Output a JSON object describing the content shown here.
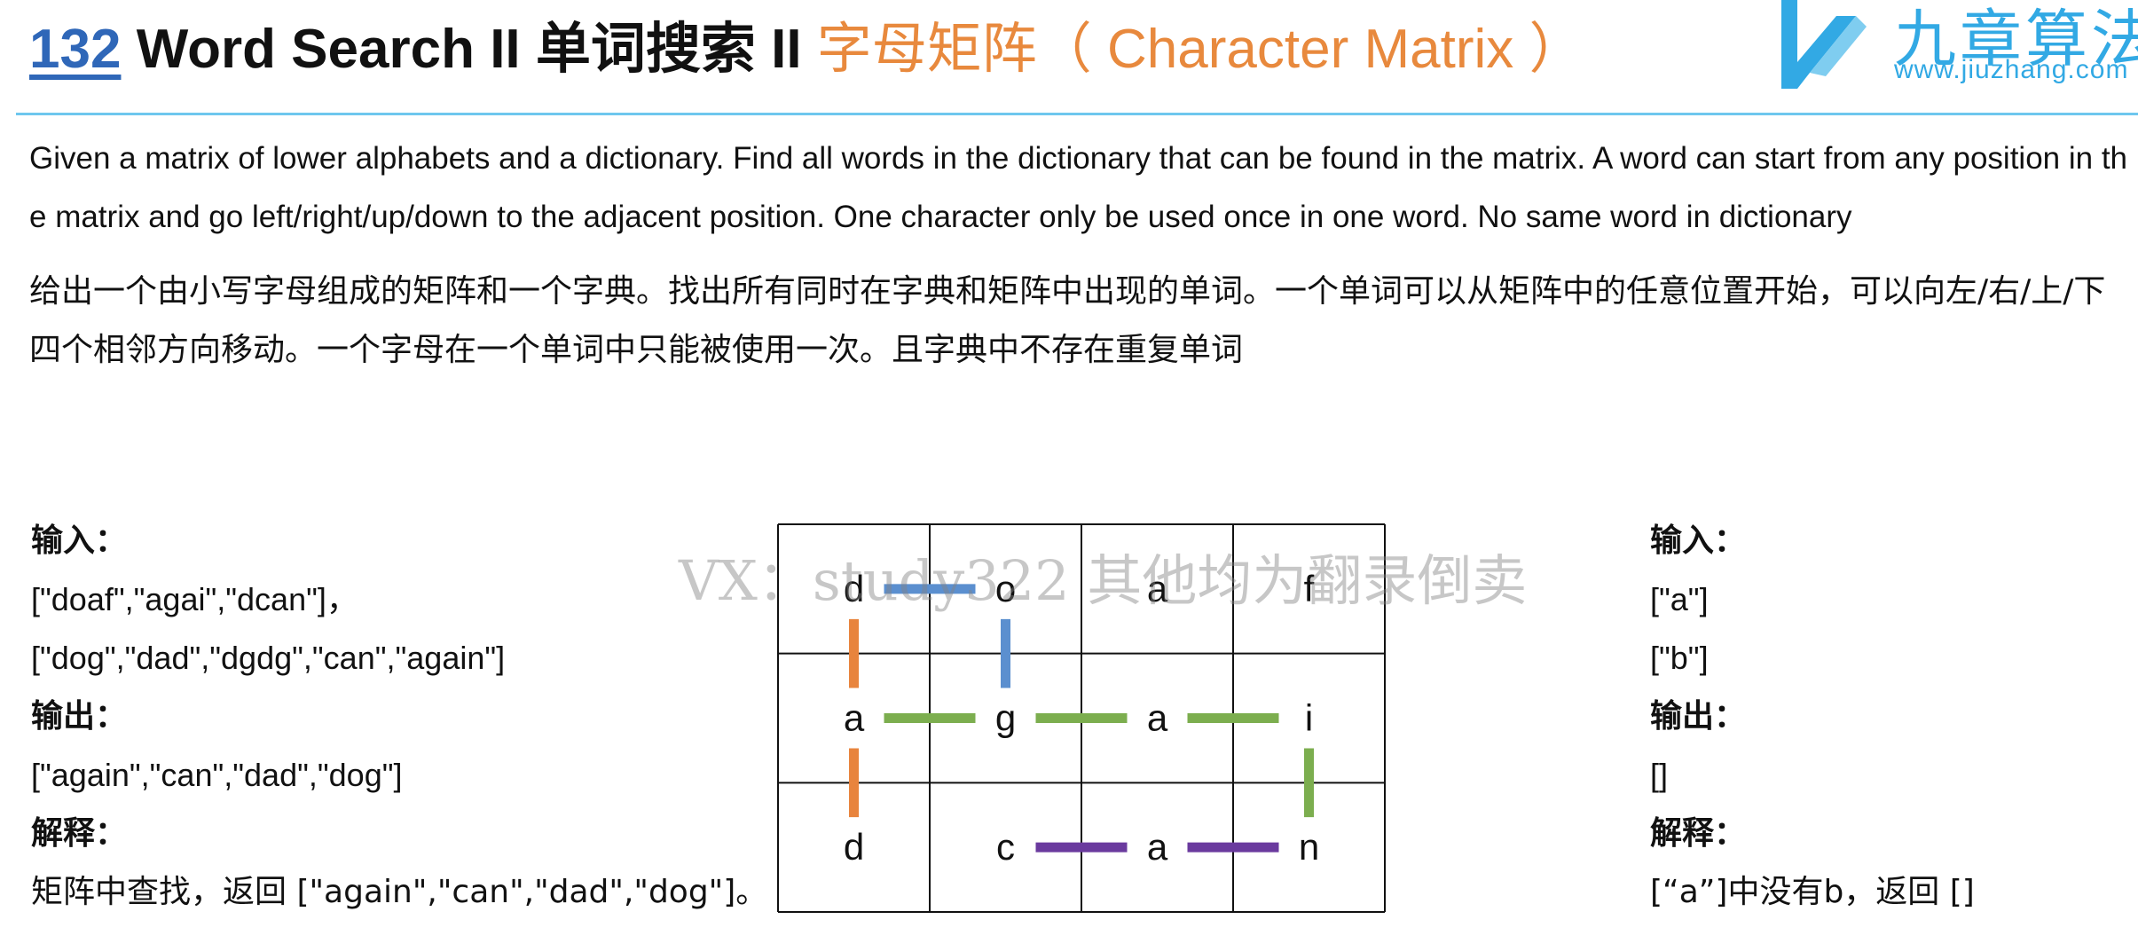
{
  "header": {
    "number": "132",
    "title_en": "Word Search II 单词搜索 II",
    "title_cn": "字母矩阵（ Character Matrix ）"
  },
  "logo": {
    "cn_text": "九章算法",
    "url": "www.jiuzhang.com"
  },
  "description": {
    "en": "Given a matrix of lower alphabets and a dictionary. Find all words in the dictionary that can be found in the matrix. A word can start from any position in the matrix and go left/right/up/down to the adjacent position. One character only be used once in one word. No same word in dictionary",
    "cn": "给出一个由小写字母组成的矩阵和一个字典。找出所有同时在字典和矩阵中出现的单词。一个单词可以从矩阵中的任意位置开始，可以向左/右/上/下四个相邻方向移动。一个字母在一个单词中只能被使用一次。且字典中不存在重复单词"
  },
  "example1": {
    "input_label": "输入：",
    "input_matrix": "[\"doaf\",\"agai\",\"dcan\"]，",
    "input_dict": "[\"dog\",\"dad\",\"dgdg\",\"can\",\"again\"]",
    "output_label": "输出：",
    "output": "[\"again\",\"can\",\"dad\",\"dog\"]",
    "explain_label": "解释：",
    "explain": "矩阵中查找，返回 [\"again\",\"can\",\"dad\",\"dog\"]。"
  },
  "example2": {
    "input_label": "输入：",
    "input_matrix": "[\"a\"]",
    "input_dict": "[\"b\"]",
    "output_label": "输出：",
    "output": "[]",
    "explain_label": "解释：",
    "explain": "[“a”]中没有b，返回 []"
  },
  "matrix": {
    "rows": [
      [
        "d",
        "o",
        "a",
        "f"
      ],
      [
        "a",
        "g",
        "a",
        "i"
      ],
      [
        "d",
        "c",
        "a",
        "n"
      ]
    ],
    "paths": [
      {
        "word": "dog",
        "color": "#5b8fcf",
        "cells": [
          [
            0,
            0
          ],
          [
            0,
            1
          ],
          [
            1,
            1
          ]
        ]
      },
      {
        "word": "dad",
        "color": "#e8843d",
        "cells": [
          [
            0,
            0
          ],
          [
            1,
            0
          ],
          [
            2,
            0
          ]
        ]
      },
      {
        "word": "again",
        "color": "#7cae4f",
        "cells": [
          [
            1,
            0
          ],
          [
            1,
            1
          ],
          [
            1,
            2
          ],
          [
            1,
            3
          ],
          [
            2,
            3
          ]
        ]
      },
      {
        "word": "can",
        "color": "#6a3a9e",
        "cells": [
          [
            2,
            1
          ],
          [
            2,
            2
          ],
          [
            2,
            3
          ]
        ]
      }
    ]
  },
  "watermark": "VX：study322 其他均为翻录倒卖",
  "colors": {
    "accent_blue": "#2f67b8",
    "accent_orange": "#e8893d",
    "rule": "#6ec7ee",
    "logo": "#32a9e4"
  }
}
